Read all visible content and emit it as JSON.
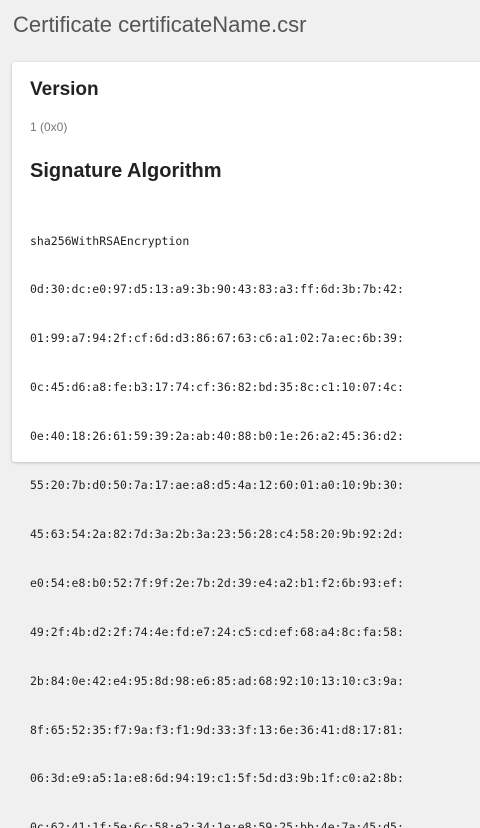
{
  "page": {
    "title": "Certificate certificateName.csr"
  },
  "version": {
    "heading": "Version",
    "value": "1 (0x0)"
  },
  "signature": {
    "heading": "Signature Algorithm",
    "algorithm": "sha256WithRSAEncryption",
    "lines": [
      "0d:30:dc:e0:97:d5:13:a9:3b:90:43:83:a3:ff:6d:3b:7b:42:",
      "01:99:a7:94:2f:cf:6d:d3:86:67:63:c6:a1:02:7a:ec:6b:39:",
      "0c:45:d6:a8:fe:b3:17:74:cf:36:82:bd:35:8c:c1:10:07:4c:",
      "0e:40:18:26:61:59:39:2a:ab:40:88:b0:1e:26:a2:45:36:d2:",
      "55:20:7b:d0:50:7a:17:ae:a8:d5:4a:12:60:01:a0:10:9b:30:",
      "45:63:54:2a:82:7d:3a:2b:3a:23:56:28:c4:58:20:9b:92:2d:",
      "e0:54:e8:b0:52:7f:9f:2e:7b:2d:39:e4:a2:b1:f2:6b:93:ef:",
      "49:2f:4b:d2:2f:74:4e:fd:e7:24:c5:cd:ef:68:a4:8c:fa:58:",
      "2b:84:0e:42:e4:95:8d:98:e6:85:ad:68:92:10:13:10:c3:9a:",
      "8f:65:52:35:f7:9a:f3:f1:9d:33:3f:13:6e:36:41:d8:17:81:",
      "06:3d:e9:a5:1a:e8:6d:94:19:c1:5f:5d:d3:9b:1f:c0:a2:8b:",
      "0c:62:41:1f:5e:6c:58:e2:34:1e:e8:59:25:bb:4e:7a:45:d5:"
    ]
  }
}
